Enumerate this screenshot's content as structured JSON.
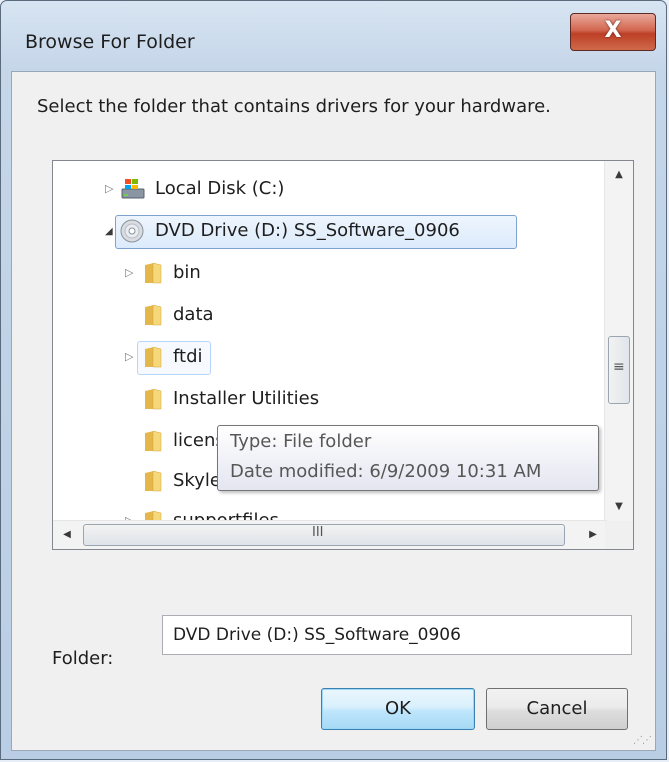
{
  "window": {
    "title": "Browse For Folder",
    "close_label": "X"
  },
  "instruction": "Select the folder that contains drivers for your hardware.",
  "tree": {
    "items": [
      {
        "label": "Local Disk (C:)",
        "icon": "drive-icon",
        "expander": "collapsed"
      },
      {
        "label": "DVD Drive (D:) SS_Software_0906",
        "icon": "dvd-icon",
        "expander": "expanded",
        "selected": true
      },
      {
        "label": "bin",
        "icon": "folder-icon",
        "expander": "collapsed"
      },
      {
        "label": "data",
        "icon": "folder-icon",
        "expander": "none"
      },
      {
        "label": "ftdi",
        "icon": "folder-icon",
        "expander": "collapsed",
        "hover": true
      },
      {
        "label": "Installer Utilities",
        "icon": "folder-icon",
        "expander": "none"
      },
      {
        "label": "licenses",
        "icon": "folder-icon",
        "expander": "none"
      },
      {
        "label": "Skylevel",
        "icon": "folder-icon",
        "expander": "none"
      },
      {
        "label": "supportfiles",
        "icon": "folder-icon",
        "expander": "collapsed"
      }
    ]
  },
  "tooltip": {
    "type_line": "Type: File folder",
    "date_line": "Date modified: 6/9/2009 10:31 AM"
  },
  "folder_field": {
    "label": "Folder:",
    "value": "DVD Drive (D:) SS_Software_0906"
  },
  "buttons": {
    "ok": "OK",
    "cancel": "Cancel"
  },
  "scrollbar": {
    "h_grip": "III",
    "v_grip": "≡"
  },
  "colors": {
    "selection_border": "#7da2ce",
    "close_button": "#c7472c"
  }
}
